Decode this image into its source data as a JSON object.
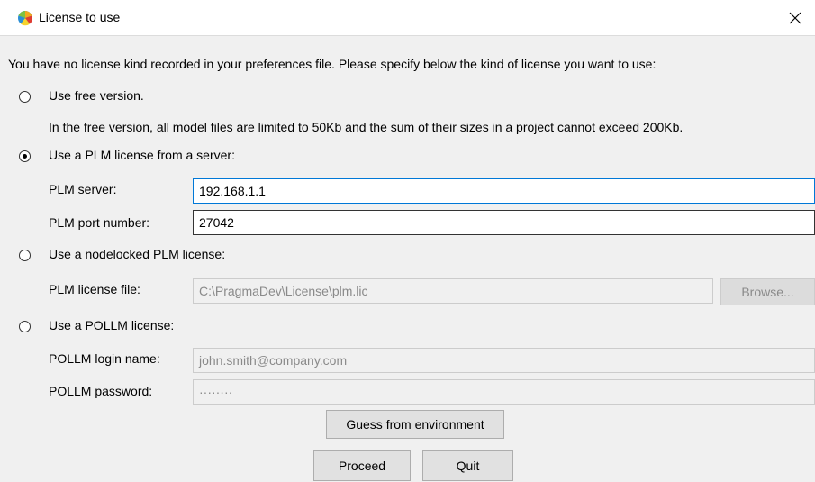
{
  "window": {
    "title": "License to use",
    "close_glyph": "✕",
    "app_icon": "pragmadev-app-icon",
    "colors": {
      "focus_border": "#0078d7",
      "disabled_text": "#8a8a8a",
      "background": "#f0f0f0"
    }
  },
  "intro": "You have no license kind recorded in your preferences file. Please specify below the kind of license you want to use:",
  "free": {
    "label": "Use free version.",
    "description": "In the free version, all model files are limited to 50Kb and the sum of their sizes in a project cannot exceed 200Kb.",
    "selected": false
  },
  "server": {
    "label": "Use a PLM license from a server:",
    "selected": true,
    "server_label": "PLM server:",
    "server_value": "192.168.1.1",
    "port_label": "PLM port number:",
    "port_value": "27042"
  },
  "nodelocked": {
    "label": "Use a nodelocked PLM license:",
    "selected": false,
    "file_label": "PLM license file:",
    "file_value": "C:\\PragmaDev\\License\\plm.lic",
    "browse_label": "Browse..."
  },
  "pollm": {
    "label": "Use a POLLM license:",
    "selected": false,
    "login_label": "POLLM login name:",
    "login_value": "john.smith@company.com",
    "password_label": "POLLM password:",
    "password_value": "········"
  },
  "buttons": {
    "guess": "Guess from environment",
    "proceed": "Proceed",
    "quit": "Quit"
  }
}
